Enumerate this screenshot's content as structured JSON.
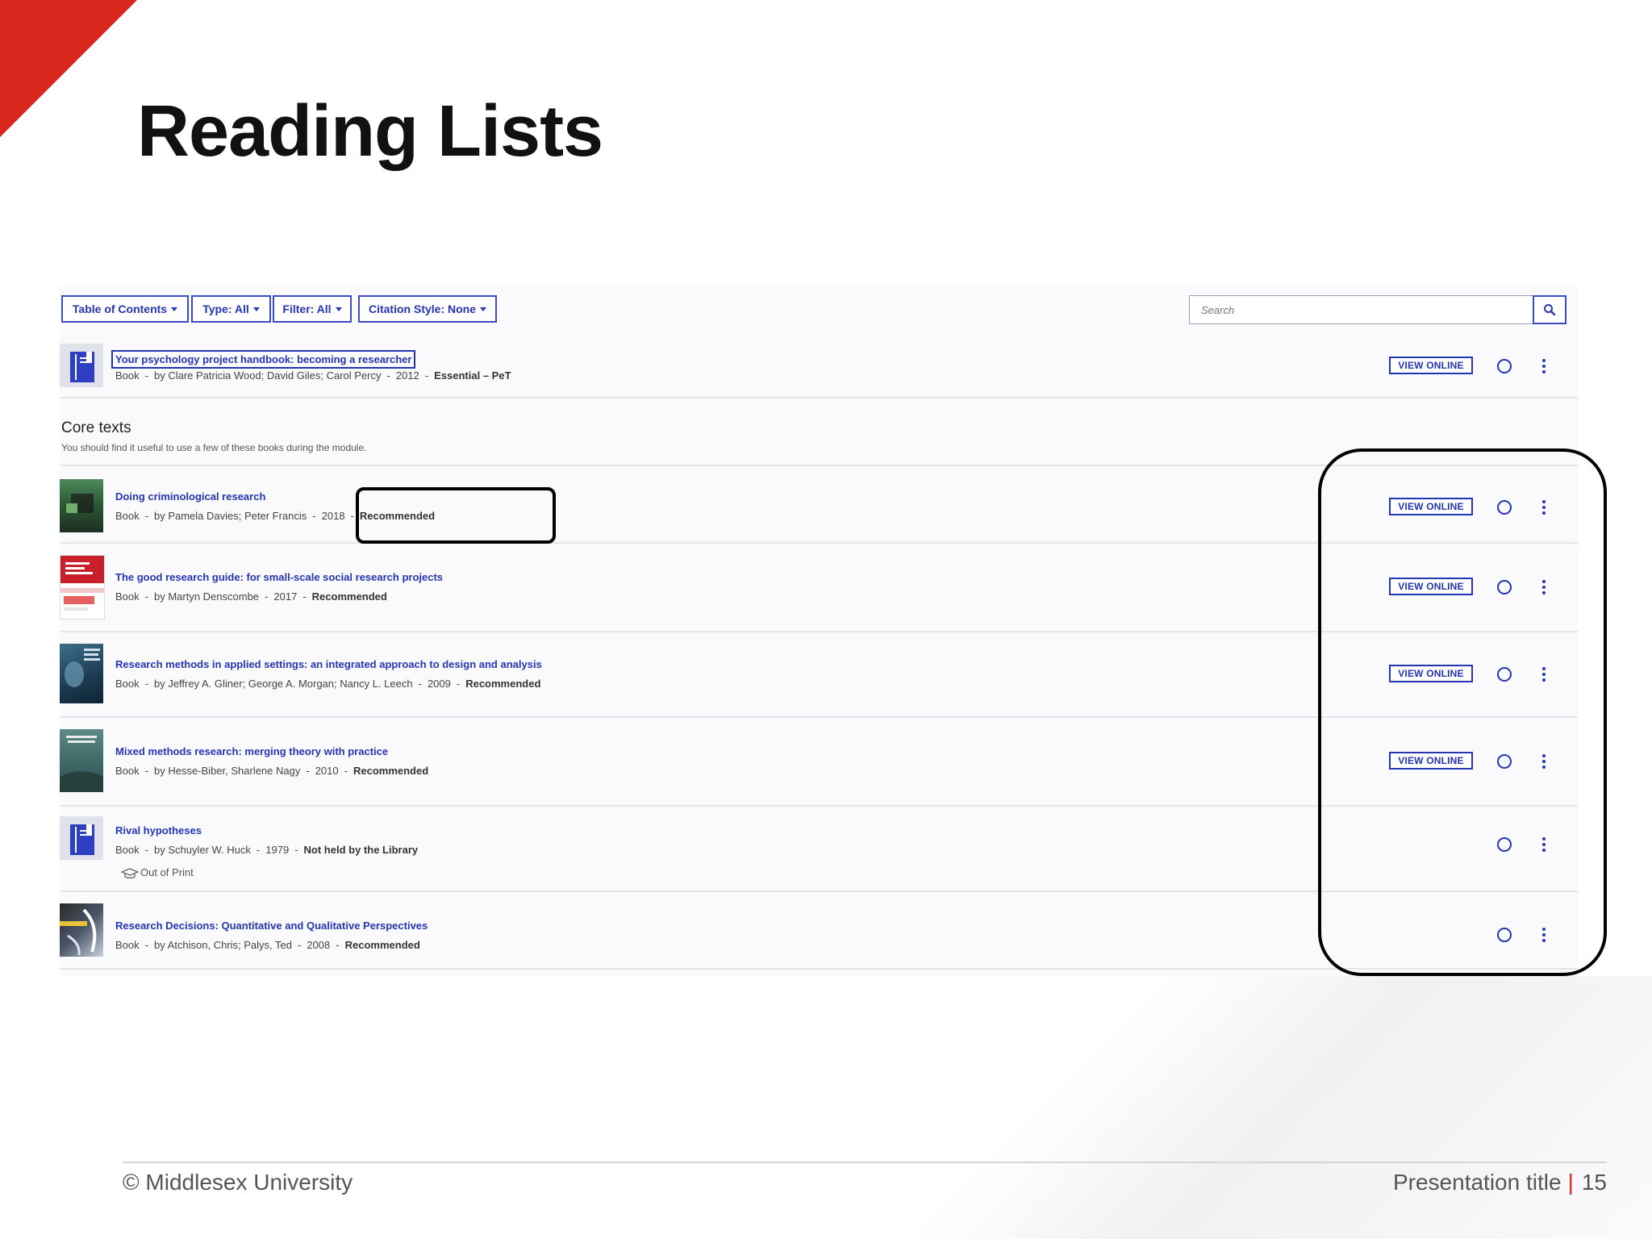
{
  "slide": {
    "title": "Reading Lists"
  },
  "toolbar": {
    "table_of_contents": "Table of Contents",
    "type": "Type: All",
    "filter": "Filter: All",
    "citation_style": "Citation Style: None",
    "search_placeholder": "Search"
  },
  "top_item": {
    "title": "Your psychology project handbook: becoming a researcher",
    "type": "Book",
    "authors": "by Clare Patricia Wood; David Giles; Carol Percy",
    "year": "2012",
    "status": "Essential – PeT",
    "view_label": "VIEW ONLINE"
  },
  "section": {
    "title": "Core texts",
    "description": "You should find it useful to use a few of these books during the module."
  },
  "items": [
    {
      "title": "Doing criminological research",
      "type": "Book",
      "authors": "by Pamela Davies; Peter Francis",
      "year": "2018",
      "status": "Recommended",
      "view_label": "VIEW ONLINE"
    },
    {
      "title": "The good research guide: for small-scale social research projects",
      "type": "Book",
      "authors": "by Martyn Denscombe",
      "year": "2017",
      "status": "Recommended",
      "view_label": "VIEW ONLINE"
    },
    {
      "title": "Research methods in applied settings: an integrated approach to design and analysis",
      "type": "Book",
      "authors": "by Jeffrey A. Gliner; George A. Morgan; Nancy L. Leech",
      "year": "2009",
      "status": "Recommended",
      "view_label": "VIEW ONLINE"
    },
    {
      "title": "Mixed methods research: merging theory with practice",
      "type": "Book",
      "authors": "by Hesse-Biber, Sharlene Nagy",
      "year": "2010",
      "status": "Recommended",
      "view_label": "VIEW ONLINE"
    },
    {
      "title": "Rival hypotheses",
      "type": "Book",
      "authors": "by Schuyler W. Huck",
      "year": "1979",
      "status": "Not held by the Library",
      "note": "Out of Print"
    },
    {
      "title": "Research Decisions: Quantitative and Qualitative Perspectives",
      "type": "Book",
      "authors": "by Atchison, Chris; Palys, Ted",
      "year": "2008",
      "status": "Recommended"
    }
  ],
  "footer": {
    "copyright": "© Middlesex University",
    "presentation_title": "Presentation title",
    "separator": "|",
    "page_number": "15"
  },
  "colors": {
    "accent_red": "#d9261c",
    "link_blue": "#2435b4"
  }
}
